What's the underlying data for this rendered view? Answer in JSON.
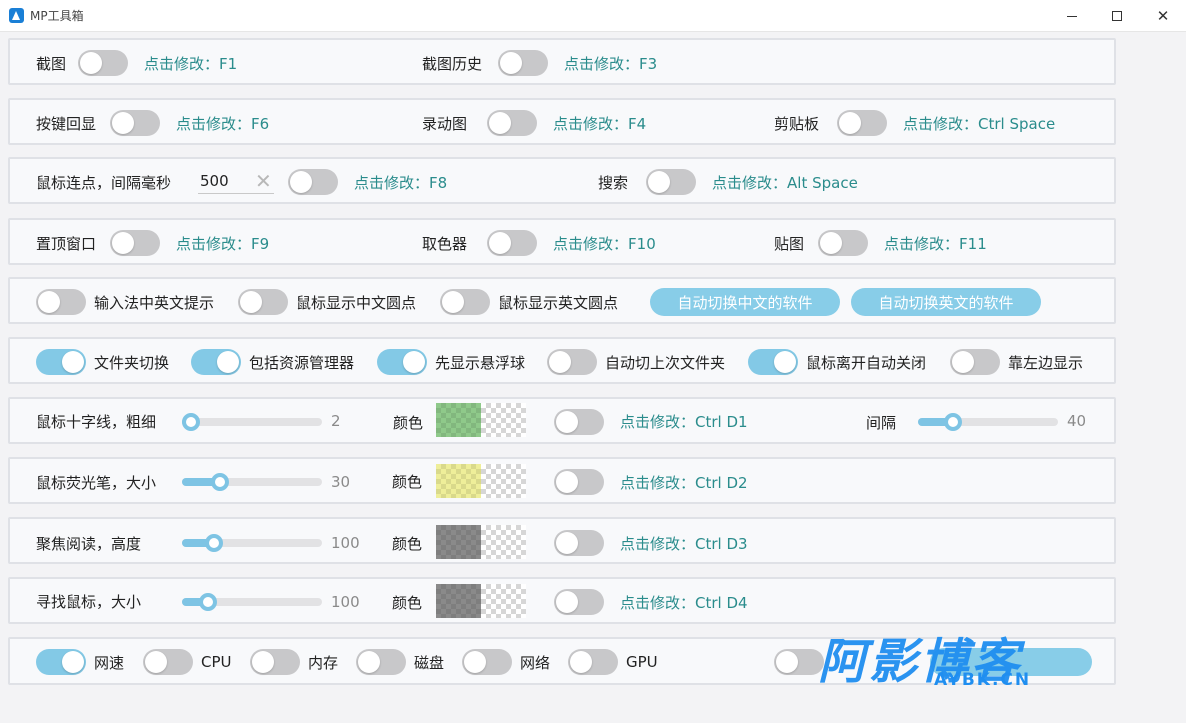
{
  "window": {
    "title": "MP工具箱",
    "accent": "#83c9e6",
    "hint_color": "#2a8c8c"
  },
  "row1": {
    "screenshot": {
      "label": "截图",
      "on": false,
      "hint": "点击修改：F1"
    },
    "history": {
      "label": "截图历史",
      "on": false,
      "hint": "点击修改：F3"
    }
  },
  "row2": {
    "keyecho": {
      "label": "按键回显",
      "on": false,
      "hint": "点击修改：F6"
    },
    "gif": {
      "label": "录动图",
      "on": false,
      "hint": "点击修改：F4"
    },
    "clipboard": {
      "label": "剪贴板",
      "on": false,
      "hint": "点击修改：Ctrl Space"
    }
  },
  "row3": {
    "autoclick": {
      "label": "鼠标连点，间隔毫秒",
      "value": "500",
      "on": false,
      "hint": "点击修改：F8"
    },
    "search": {
      "label": "搜索",
      "on": false,
      "hint": "点击修改：Alt Space"
    }
  },
  "row4": {
    "topmost": {
      "label": "置顶窗口",
      "on": false,
      "hint": "点击修改：F9"
    },
    "picker": {
      "label": "取色器",
      "on": false,
      "hint": "点击修改：F10"
    },
    "pin": {
      "label": "贴图",
      "on": false,
      "hint": "点击修改：F11"
    }
  },
  "row5": {
    "ime_hint": {
      "label": "输入法中英文提示",
      "on": false
    },
    "cn_dot": {
      "label": "鼠标显示中文圆点",
      "on": false
    },
    "en_dot": {
      "label": "鼠标显示英文圆点",
      "on": false
    },
    "btn_cn": "自动切换中文的软件",
    "btn_en": "自动切换英文的软件"
  },
  "row6": {
    "folder_switch": {
      "label": "文件夹切换",
      "on": true
    },
    "explorer": {
      "label": "包括资源管理器",
      "on": true
    },
    "float_ball": {
      "label": "先显示悬浮球",
      "on": true
    },
    "last_folder": {
      "label": "自动切上次文件夹",
      "on": false
    },
    "auto_close": {
      "label": "鼠标离开自动关闭",
      "on": true
    },
    "left_edge": {
      "label": "靠左边显示",
      "on": false
    }
  },
  "row7": {
    "label": "鼠标十字线，粗细",
    "value": "2",
    "fraction": 0.0,
    "color_label": "颜色",
    "color": "#8fc98a",
    "on": false,
    "hint": "点击修改：Ctrl D1",
    "gap_label": "间隔",
    "gap_value": "40",
    "gap_fraction": 0.21
  },
  "row8": {
    "label": "鼠标荧光笔，大小",
    "value": "30",
    "fraction": 0.24,
    "color_label": "颜色",
    "color": "#eeee99",
    "on": false,
    "hint": "点击修改：Ctrl D2"
  },
  "row9": {
    "label": "聚焦阅读，高度",
    "value": "100",
    "fraction": 0.19,
    "color_label": "颜色",
    "color": "#8a8a8a",
    "on": false,
    "hint": "点击修改：Ctrl D3"
  },
  "row10": {
    "label": "寻找鼠标，大小",
    "value": "100",
    "fraction": 0.14,
    "color_label": "颜色",
    "color": "#8a8a8a",
    "on": false,
    "hint": "点击修改：Ctrl D4"
  },
  "row11": {
    "speed": {
      "label": "网速",
      "on": true
    },
    "cpu": {
      "label": "CPU",
      "on": false
    },
    "mem": {
      "label": "内存",
      "on": false
    },
    "disk": {
      "label": "磁盘",
      "on": false
    },
    "net": {
      "label": "网络",
      "on": false
    },
    "gpu": {
      "label": "GPU",
      "on": false
    },
    "autostart": {
      "on": false
    }
  },
  "watermark": {
    "main": "阿影博客",
    "sub": "AYBK.CN"
  }
}
